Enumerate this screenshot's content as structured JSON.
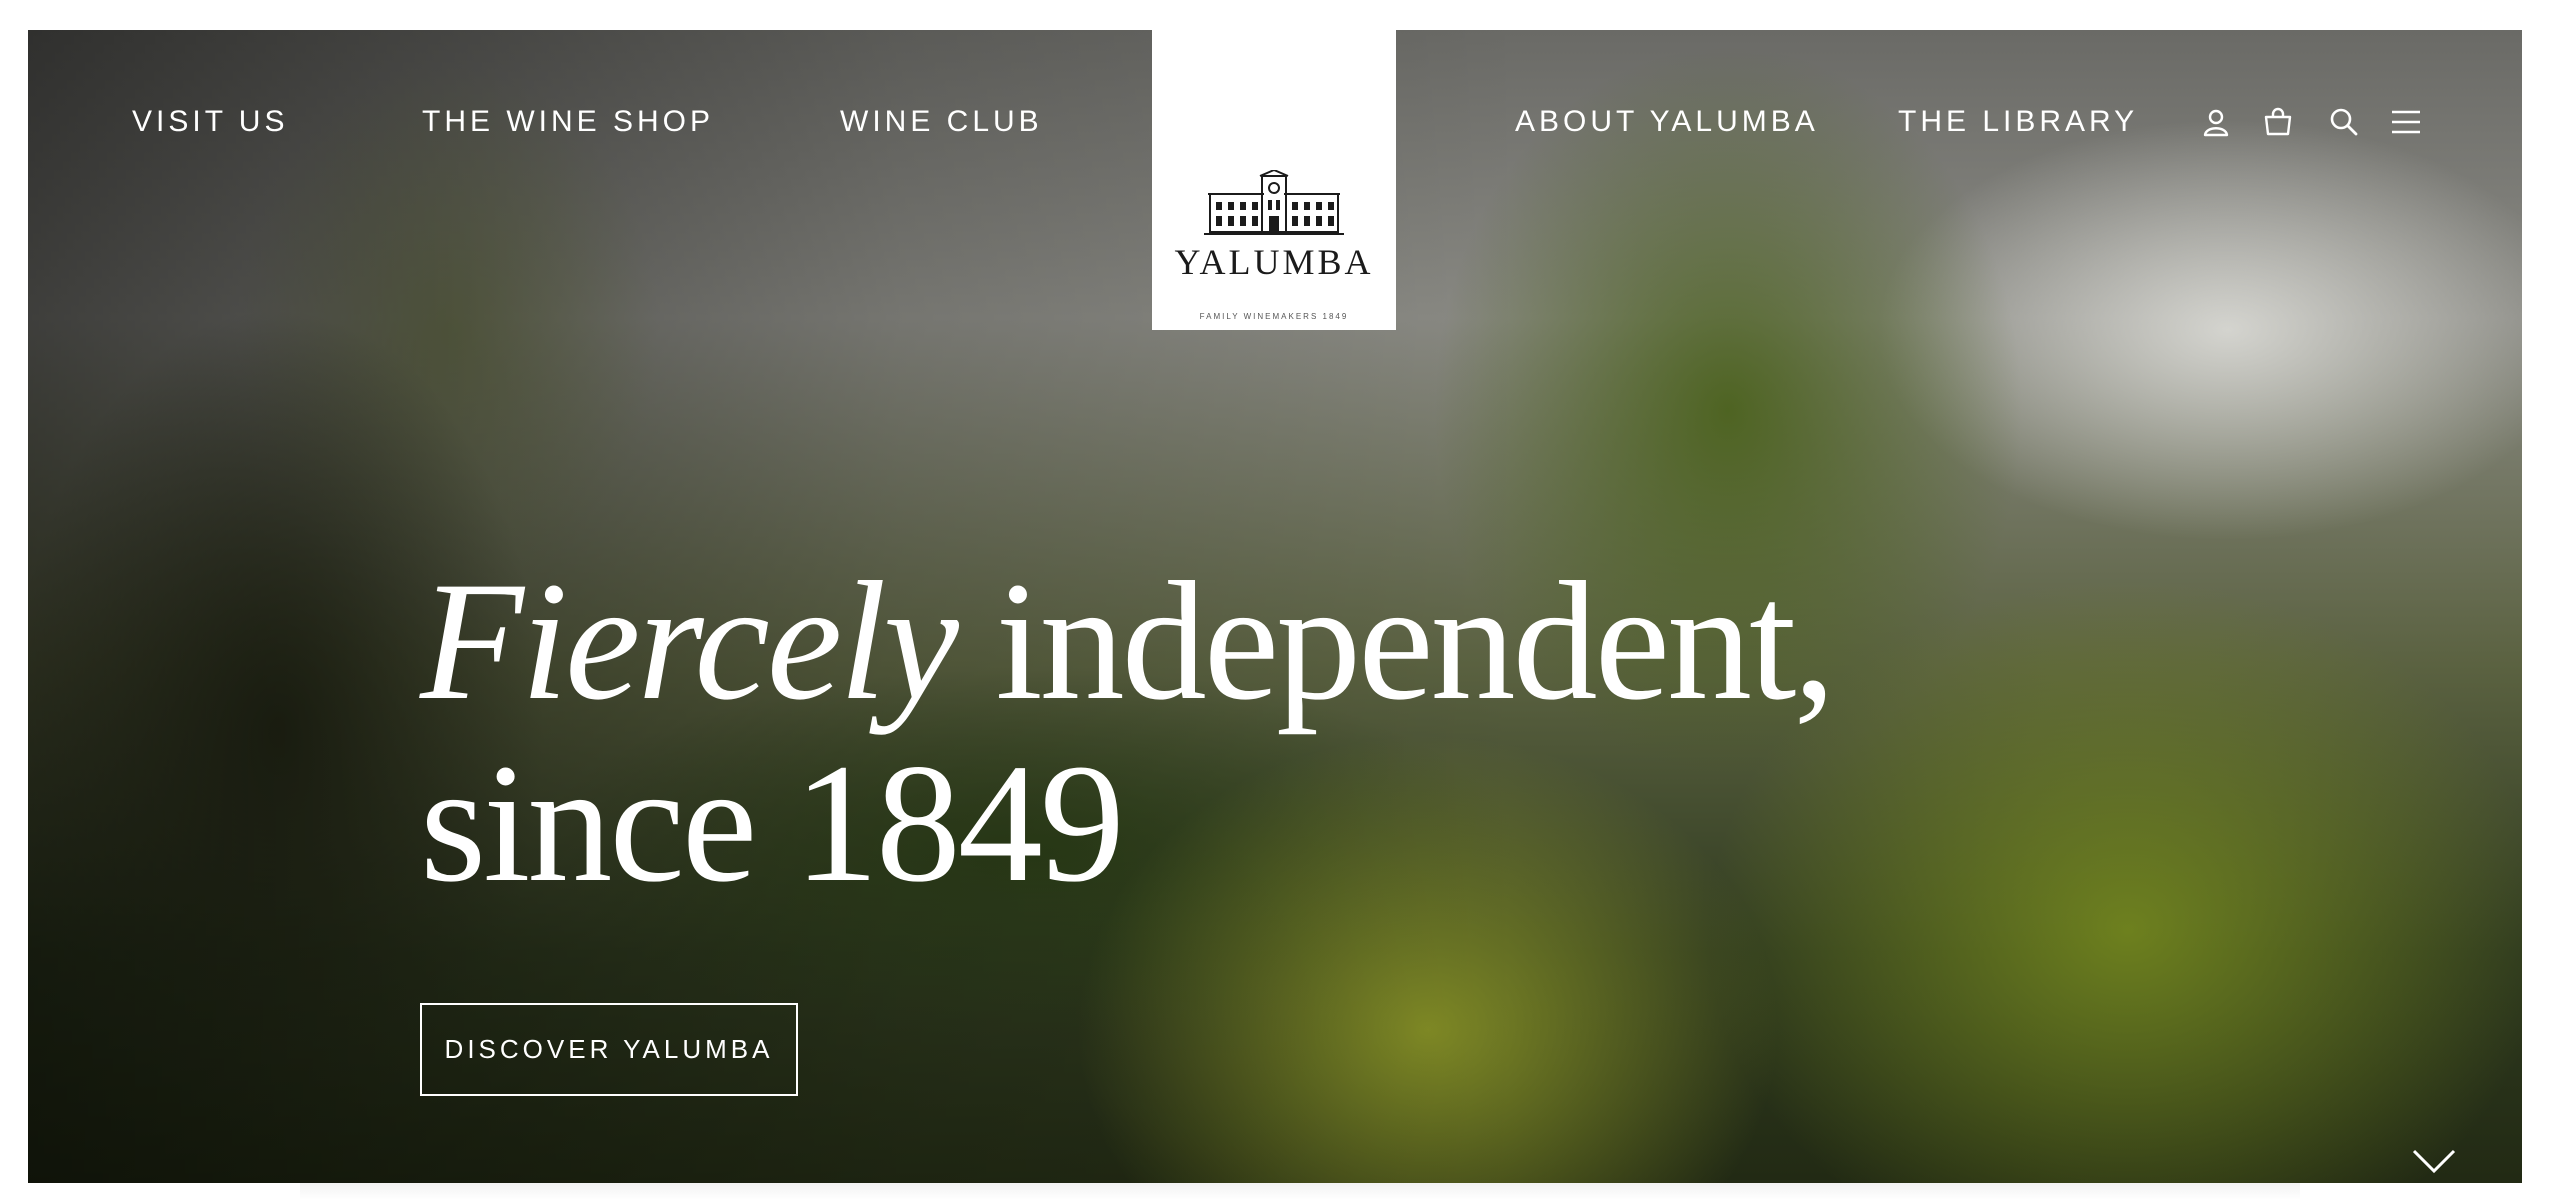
{
  "nav": {
    "left": [
      "VISIT US",
      "THE WINE SHOP",
      "WINE CLUB"
    ],
    "right": [
      "ABOUT YALUMBA",
      "THE LIBRARY"
    ]
  },
  "logo": {
    "name": "YALUMBA",
    "tagline": "FAMILY WINEMAKERS 1849"
  },
  "header_icons": [
    "account-icon",
    "shopping-bag-icon",
    "search-icon",
    "menu-icon"
  ],
  "hero": {
    "headline_italic": "Fiercely",
    "headline_rest": " independent,",
    "headline_line2": "since 1849",
    "cta_label": "DISCOVER YALUMBA"
  }
}
